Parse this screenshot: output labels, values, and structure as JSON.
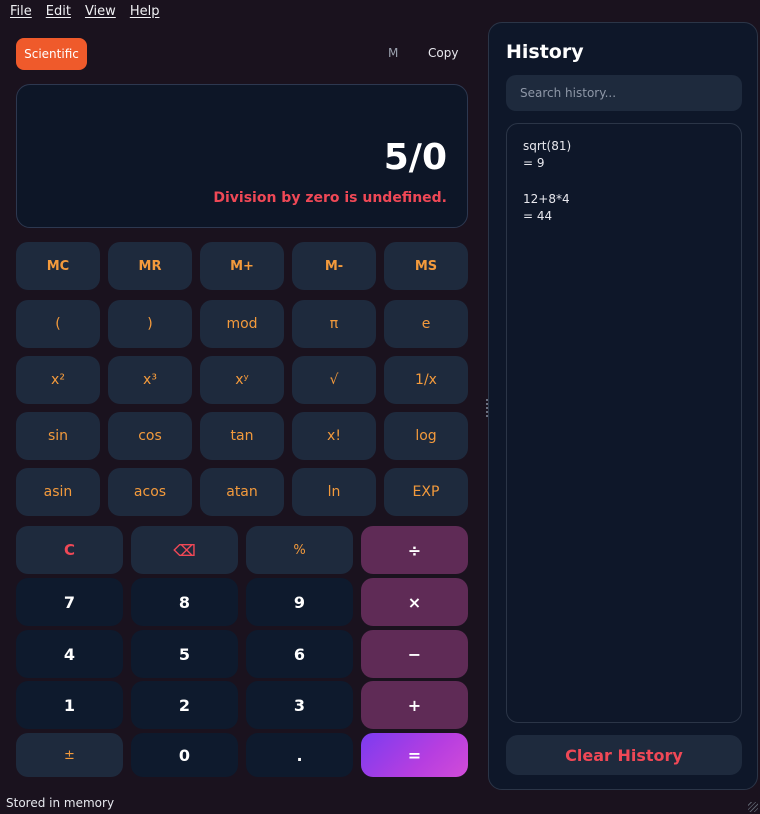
{
  "menu": [
    "File",
    "Edit",
    "View",
    "Help"
  ],
  "toolbar": {
    "mode": "Scientific",
    "memory": "M",
    "copy": "Copy"
  },
  "display": {
    "expression": "5/0",
    "error": "Division by zero is undefined."
  },
  "memory_keys": [
    "MC",
    "MR",
    "M+",
    "M-",
    "MS"
  ],
  "sci_rows": [
    [
      "(",
      ")",
      "mod",
      "π",
      "e"
    ],
    [
      "x²",
      "x³",
      "xʸ",
      "√",
      "1/x"
    ],
    [
      "sin",
      "cos",
      "tan",
      "x!",
      "log"
    ],
    [
      "asin",
      "acos",
      "atan",
      "ln",
      "EXP"
    ]
  ],
  "keypad": [
    [
      {
        "label": "C",
        "kind": "clear"
      },
      {
        "label": "⌫",
        "kind": "back"
      },
      {
        "label": "%",
        "kind": "func"
      },
      {
        "label": "÷",
        "kind": "op"
      }
    ],
    [
      {
        "label": "7",
        "kind": "digit"
      },
      {
        "label": "8",
        "kind": "digit"
      },
      {
        "label": "9",
        "kind": "digit"
      },
      {
        "label": "×",
        "kind": "op"
      }
    ],
    [
      {
        "label": "4",
        "kind": "digit"
      },
      {
        "label": "5",
        "kind": "digit"
      },
      {
        "label": "6",
        "kind": "digit"
      },
      {
        "label": "−",
        "kind": "op"
      }
    ],
    [
      {
        "label": "1",
        "kind": "digit"
      },
      {
        "label": "2",
        "kind": "digit"
      },
      {
        "label": "3",
        "kind": "digit"
      },
      {
        "label": "+",
        "kind": "op"
      }
    ],
    [
      {
        "label": "±",
        "kind": "func"
      },
      {
        "label": "0",
        "kind": "digit"
      },
      {
        "label": ".",
        "kind": "digit"
      },
      {
        "label": "=",
        "kind": "equals"
      }
    ]
  ],
  "history": {
    "title": "History",
    "search_placeholder": "Search history...",
    "entries": [
      {
        "expr": "sqrt(81)",
        "result": "= 9"
      },
      {
        "expr": "12+8*4",
        "result": "= 44"
      }
    ],
    "clear_label": "Clear History"
  },
  "status": "Stored in memory",
  "colors": {
    "accent": "#ef5a2b",
    "error": "#ef4856",
    "operator": "#5f2b56",
    "key_text": "#f39a3c"
  }
}
